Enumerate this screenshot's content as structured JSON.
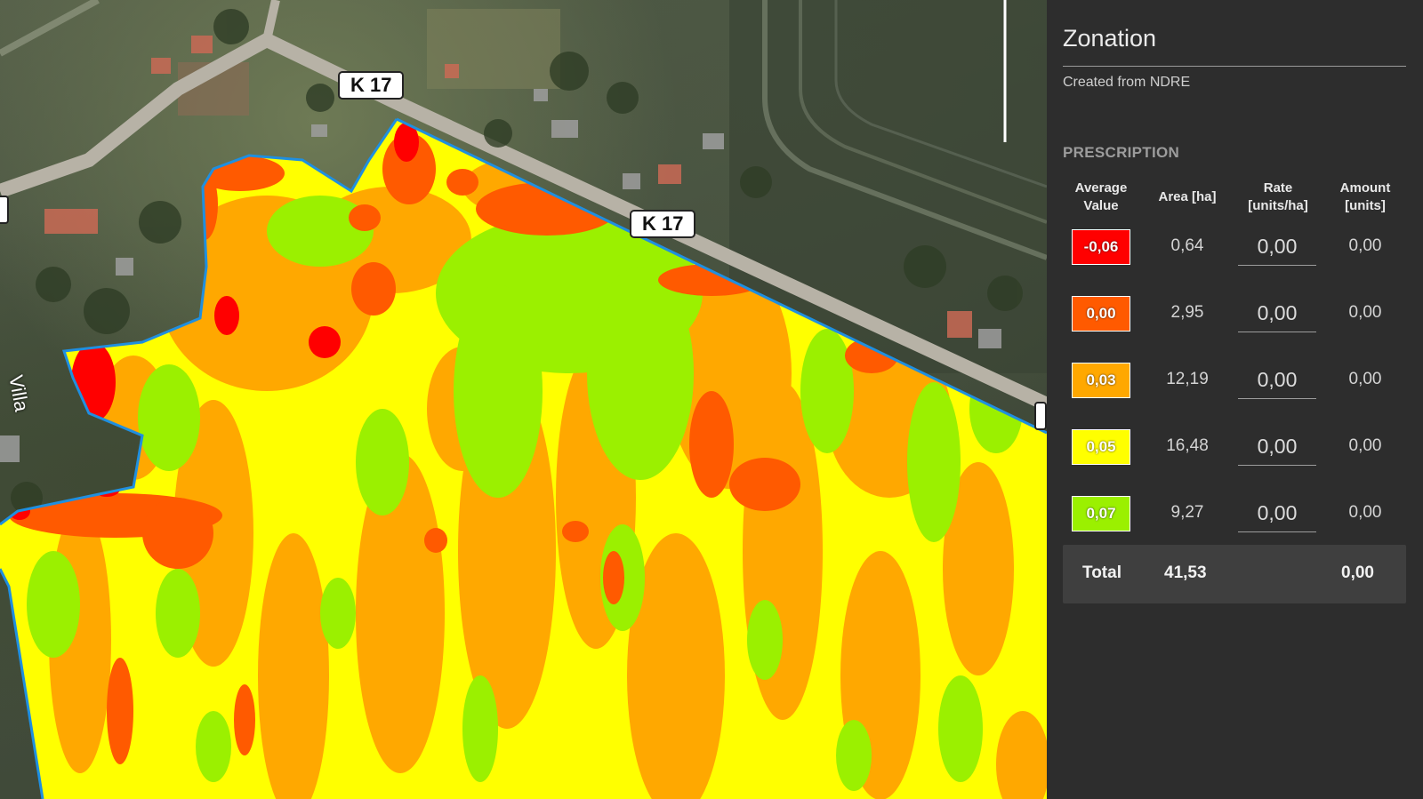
{
  "map": {
    "road_labels": [
      "K 17",
      "K 17"
    ],
    "street_name": "Villa",
    "zone_colors": [
      "#ff0000",
      "#ff5a00",
      "#ffa800",
      "#ffff00",
      "#9bf000"
    ],
    "boundary_color": "#1f8fe0"
  },
  "panel": {
    "title": "Zonation",
    "subtitle": "Created from NDRE",
    "section_label": "PRESCRIPTION",
    "columns": {
      "average_value": "Average Value",
      "area": "Area [ha]",
      "rate": "Rate [units/ha]",
      "amount": "Amount [units]"
    },
    "rows": [
      {
        "value": "-0,06",
        "color": "#ff0000",
        "area": "0,64",
        "rate": "0,00",
        "amount": "0,00"
      },
      {
        "value": "0,00",
        "color": "#ff5a00",
        "area": "2,95",
        "rate": "0,00",
        "amount": "0,00"
      },
      {
        "value": "0,03",
        "color": "#ffa800",
        "area": "12,19",
        "rate": "0,00",
        "amount": "0,00"
      },
      {
        "value": "0,05",
        "color": "#ffff00",
        "area": "16,48",
        "rate": "0,00",
        "amount": "0,00"
      },
      {
        "value": "0,07",
        "color": "#9bf000",
        "area": "9,27",
        "rate": "0,00",
        "amount": "0,00"
      }
    ],
    "total": {
      "label": "Total",
      "area": "41,53",
      "amount": "0,00"
    }
  }
}
